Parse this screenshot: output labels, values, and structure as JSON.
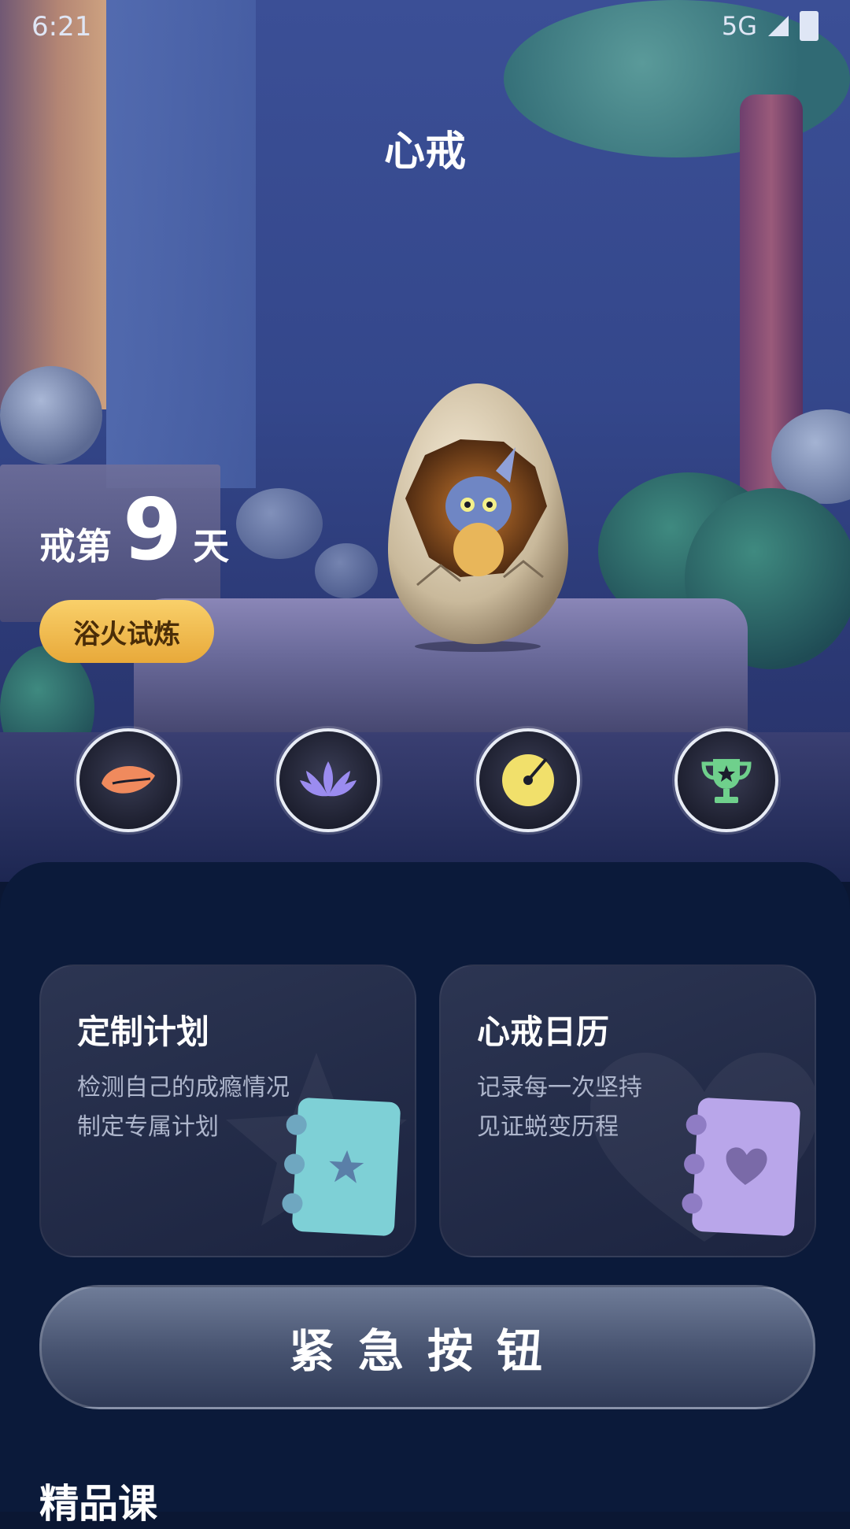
{
  "status_bar": {
    "time": "6:21",
    "network": "5G"
  },
  "header": {
    "title": "心戒"
  },
  "progress": {
    "prefix": "戒第",
    "days": "9",
    "suffix": "天",
    "badge": "浴火试炼"
  },
  "features": [
    {
      "label": "木鱼",
      "icon": "wooden-fish-icon",
      "color": "#f08a5d"
    },
    {
      "label": "冥想",
      "icon": "lotus-icon",
      "color": "#9b8cf0"
    },
    {
      "label": "专注",
      "icon": "target-disc-icon",
      "color": "#f1e06b"
    },
    {
      "label": "挑战",
      "icon": "trophy-icon",
      "color": "#6fd08c"
    }
  ],
  "cards": {
    "plan": {
      "title": "定制计划",
      "line1": "检测自己的成瘾情况",
      "line2": "制定专属计划",
      "color": "#7ed0d6"
    },
    "calendar": {
      "title": "心戒日历",
      "line1": "记录每一次坚持",
      "line2": "见证蜕变历程",
      "color": "#b9a6ea"
    }
  },
  "emergency": {
    "label": "紧急按钮"
  },
  "section": {
    "title": "精品课"
  }
}
